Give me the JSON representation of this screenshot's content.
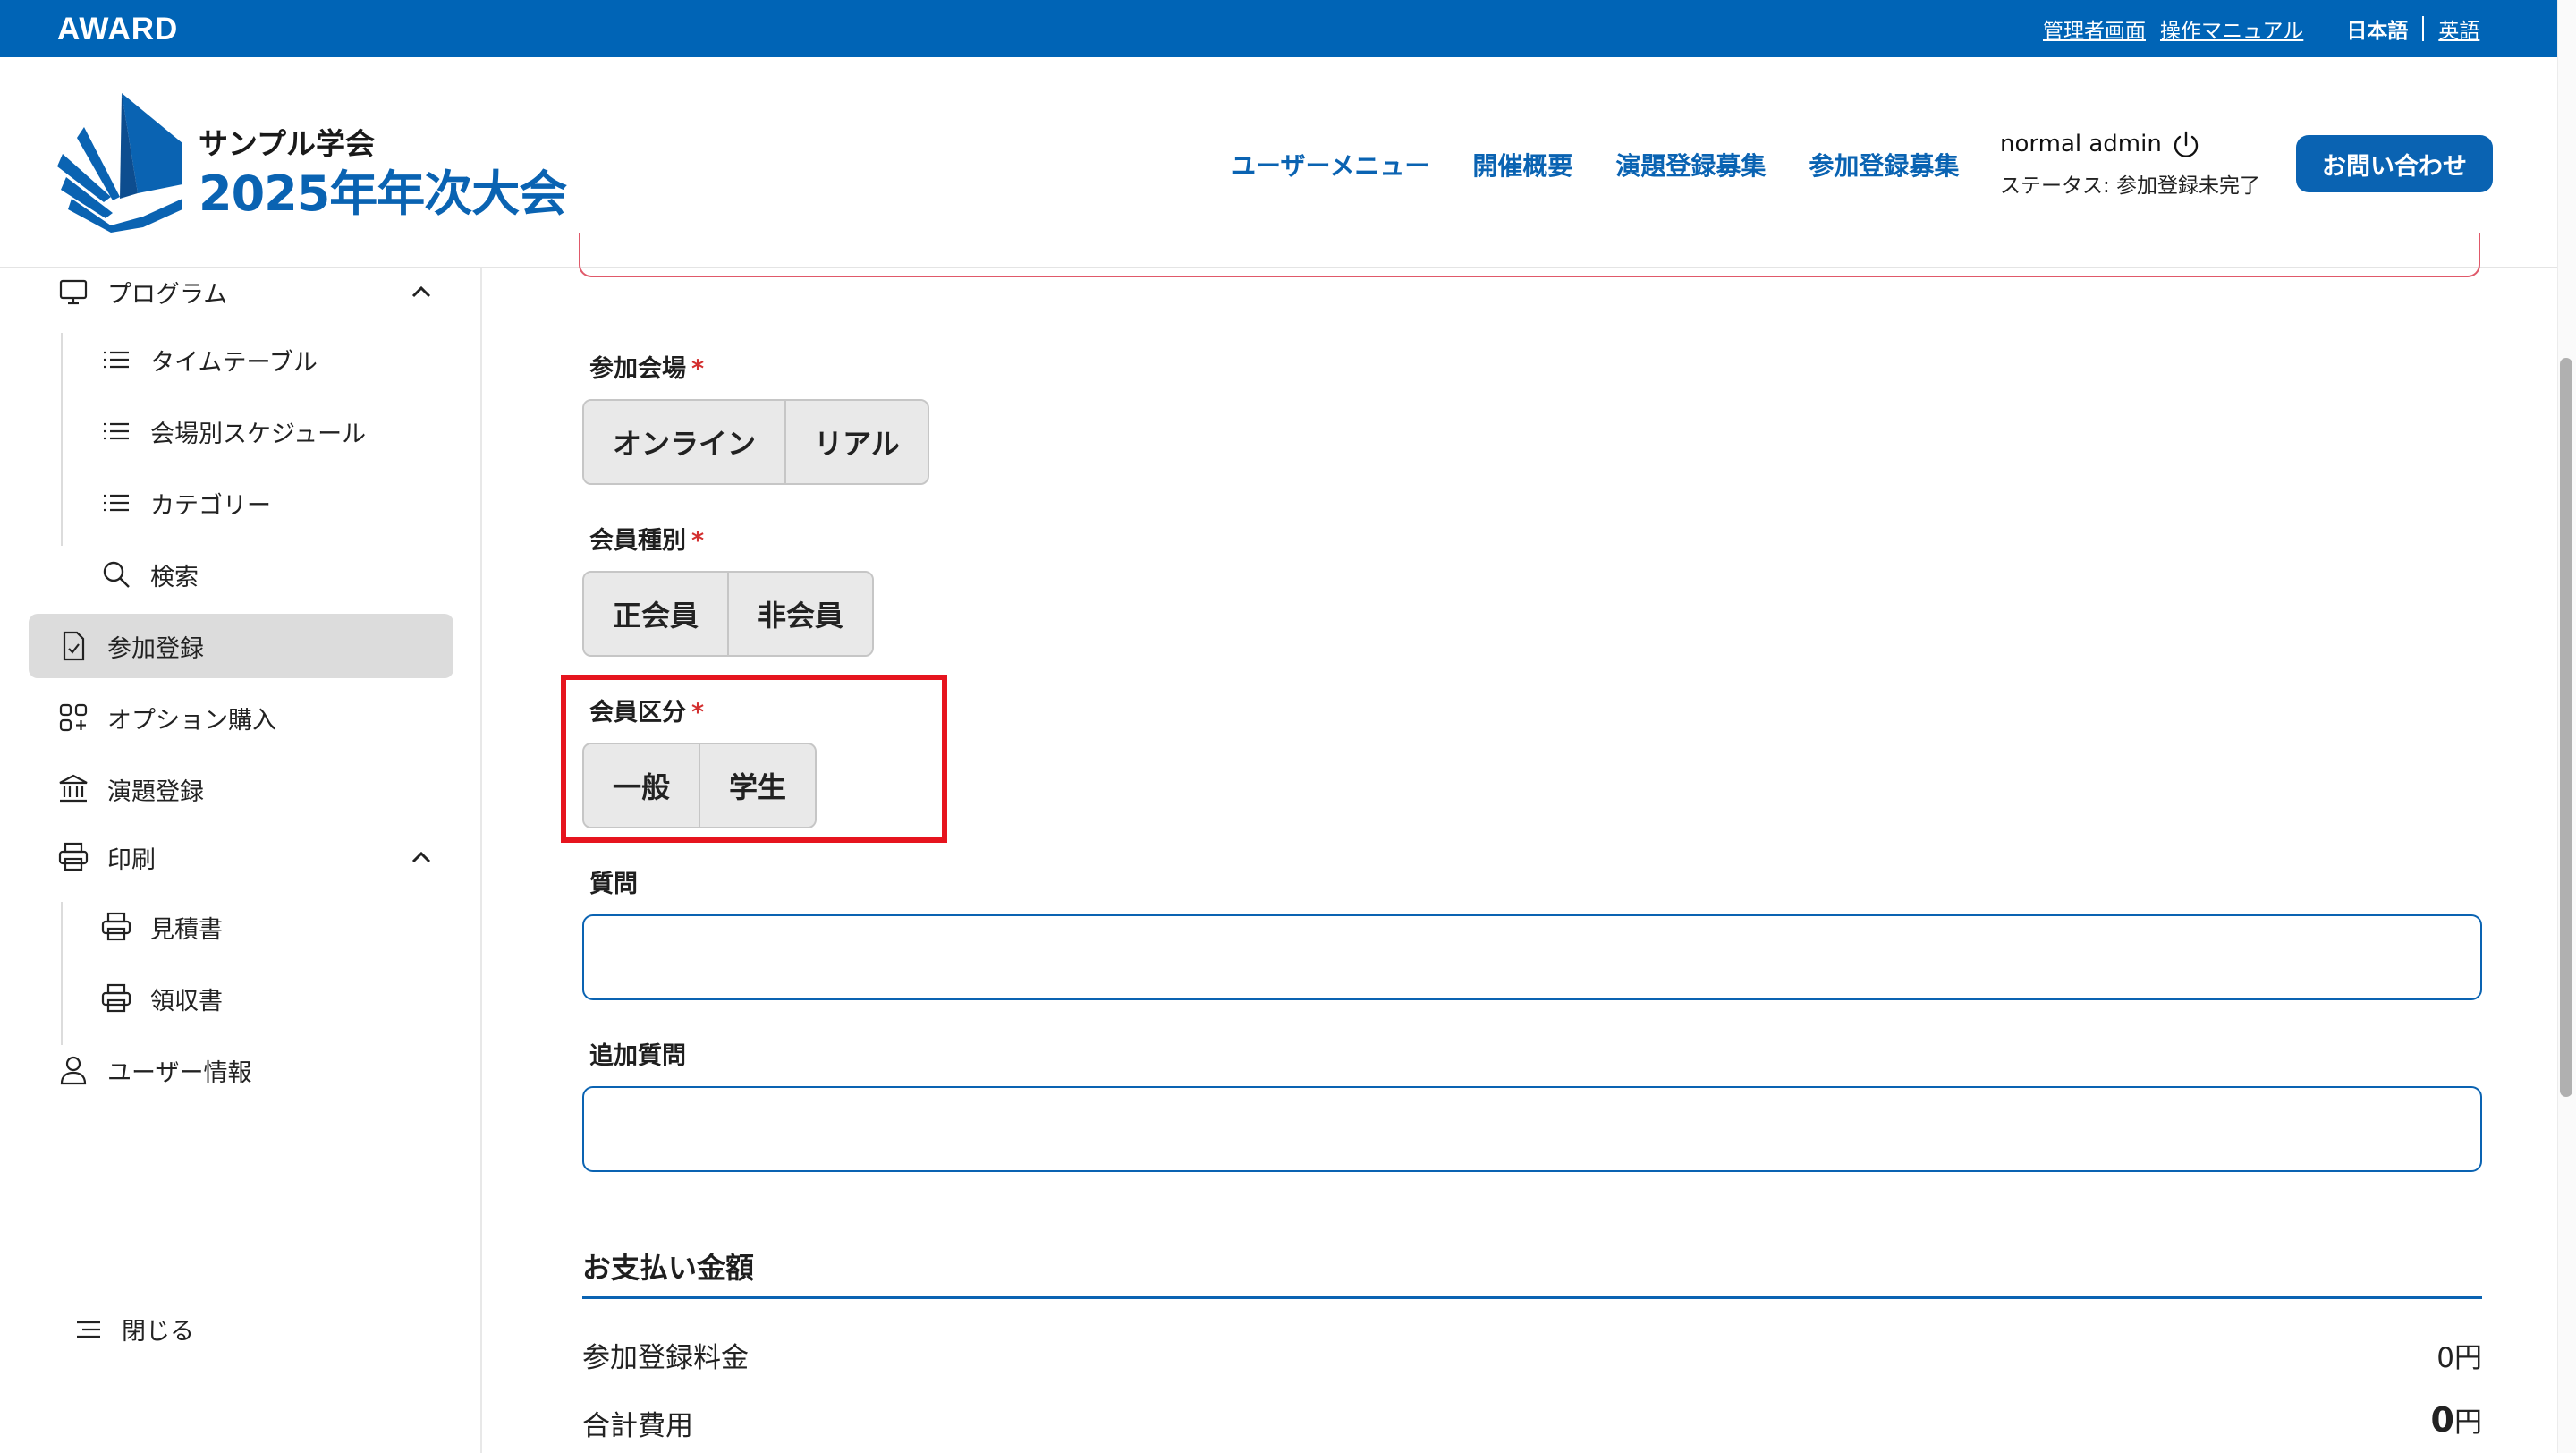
{
  "topbar": {
    "brand": "AWARD",
    "links": [
      "管理者画面",
      "操作マニュアル"
    ],
    "lang_current": "日本語",
    "lang_alt": "英語"
  },
  "header": {
    "conference_sub": "サンプル学会",
    "conference_title": "2025年年次大会",
    "nav": [
      "ユーザーメニュー",
      "開催概要",
      "演題登録募集",
      "参加登録募集"
    ],
    "user_name": "normal admin",
    "user_status": "ステータス: 参加登録未完了",
    "contact_label": "お問い合わせ"
  },
  "sidebar": {
    "program": "プログラム",
    "timetable": "タイムテーブル",
    "venue_schedule": "会場別スケジュール",
    "category": "カテゴリー",
    "search": "検索",
    "registration": "参加登録",
    "option_purchase": "オプション購入",
    "abstract_registration": "演題登録",
    "print": "印刷",
    "quotation": "見積書",
    "receipt": "領収書",
    "user_info": "ユーザー情報",
    "close": "閉じる"
  },
  "form": {
    "venue": {
      "label": "参加会場",
      "required": "*",
      "options": [
        "オンライン",
        "リアル"
      ]
    },
    "member_type": {
      "label": "会員種別",
      "required": "*",
      "options": [
        "正会員",
        "非会員"
      ]
    },
    "member_class": {
      "label": "会員区分",
      "required": "*",
      "options": [
        "一般",
        "学生"
      ]
    },
    "question": {
      "label": "質問",
      "value": ""
    },
    "additional_question": {
      "label": "追加質問",
      "value": ""
    }
  },
  "payment": {
    "title": "お支払い金額",
    "registration_fee_label": "参加登録料金",
    "registration_fee_value": "0",
    "total_label": "合計費用",
    "total_value": "0",
    "currency": "円"
  },
  "colors": {
    "primary": "#0064b6",
    "accent_text": "#0a63b2",
    "highlight": "#e6141e",
    "required": "#d32f2f"
  }
}
